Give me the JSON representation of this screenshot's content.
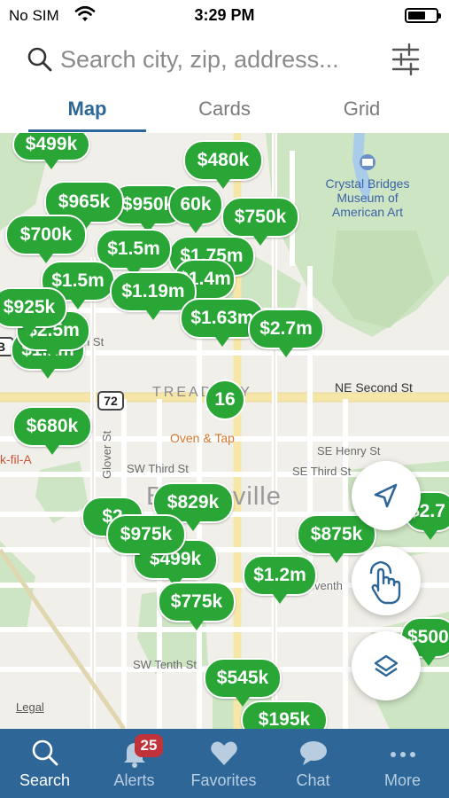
{
  "status_bar": {
    "carrier": "No SIM",
    "time": "3:29 PM"
  },
  "search": {
    "placeholder": "Search city, zip, address..."
  },
  "tabs": [
    {
      "label": "Map",
      "active": true
    },
    {
      "label": "Cards",
      "active": false
    },
    {
      "label": "Grid",
      "active": false
    }
  ],
  "map": {
    "city": "Bentonville",
    "poi": "Crystal Bridges Museum of American Art",
    "streets": {
      "tread": "TREADWAY",
      "ne_second": "NE Second St",
      "se_henry": "SE Henry St",
      "se_third": "SE Third St",
      "sw_third": "SW Third St",
      "sw_tenth": "SW Tenth St",
      "glover": "Glover St",
      "person": "rson St",
      "se_seventh": "venth"
    },
    "highway": "72",
    "shield_b": "B",
    "business": "Oven & Tap",
    "chick": "k-fil-A",
    "legal": "Legal",
    "cluster_count": "16",
    "prices": [
      "$499k",
      "$480k",
      "$965k",
      "$950k",
      "$750k",
      "$700k",
      "$1.5m",
      "$1.5m",
      "$1.19m",
      "$1.4m",
      "$925k",
      "$2.5m",
      "$1.63m",
      "$2.7m",
      "$680k",
      "$829k",
      "$975k",
      "$499k",
      "$875k",
      "$1.2m",
      "$775k",
      "$545k",
      "$500",
      "$2.7",
      "$195k",
      "$2",
      "$1.75m",
      "$1.1m",
      "60k"
    ]
  },
  "bottom_nav": [
    {
      "label": "Search",
      "icon": "search-icon",
      "active": true
    },
    {
      "label": "Alerts",
      "icon": "bell-icon",
      "badge": "25"
    },
    {
      "label": "Favorites",
      "icon": "heart-icon"
    },
    {
      "label": "Chat",
      "icon": "chat-icon"
    },
    {
      "label": "More",
      "icon": "more-icon"
    }
  ],
  "colors": {
    "accent": "#2e6797",
    "pin": "#2aa637",
    "badge": "#c0333a"
  }
}
